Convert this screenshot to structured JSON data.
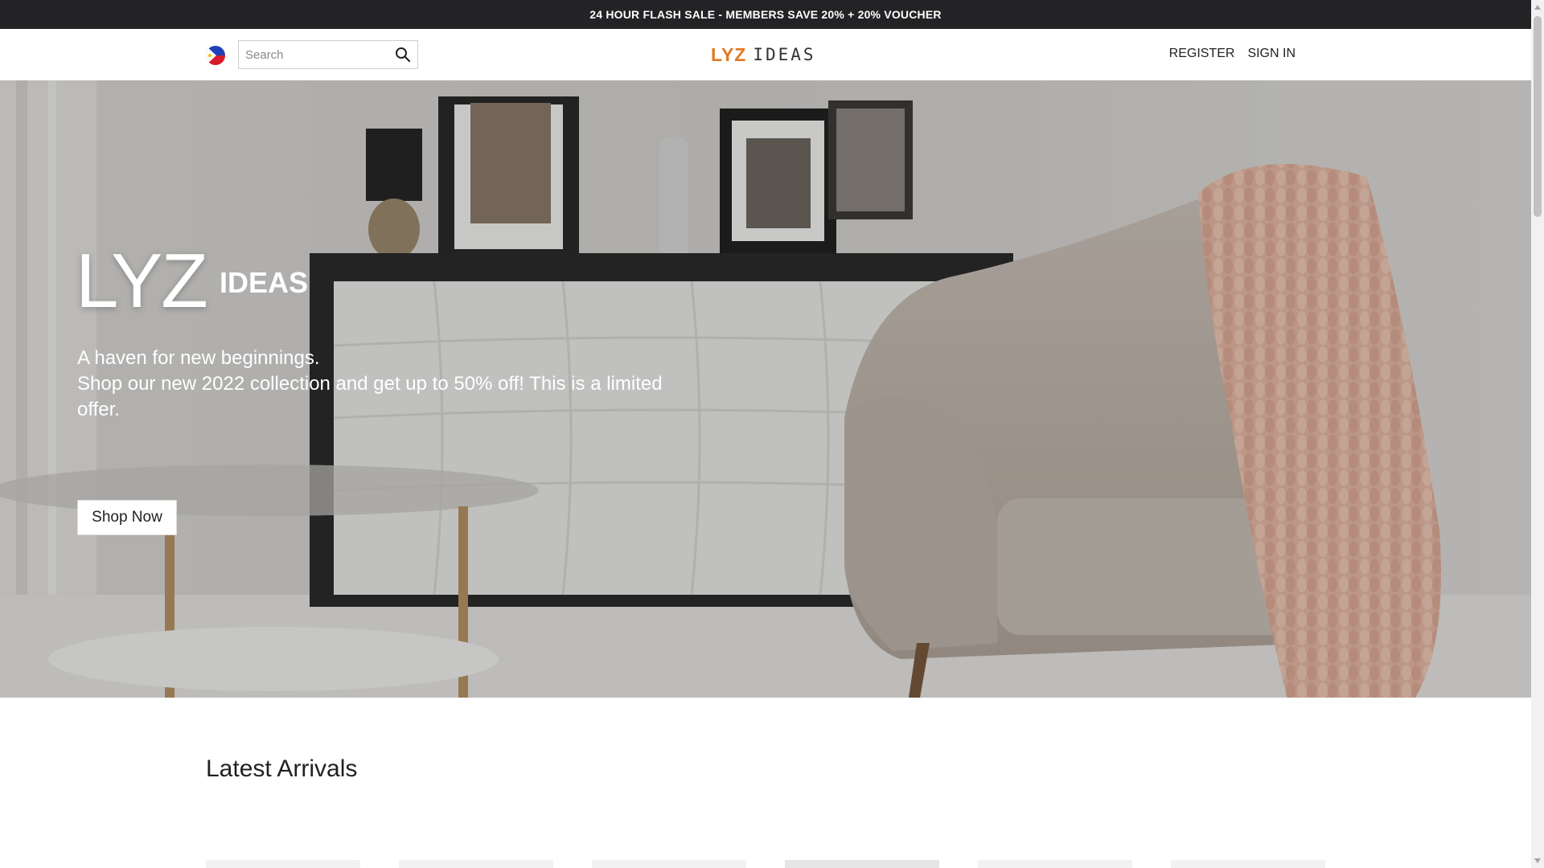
{
  "announcement": "24 HOUR FLASH SALE - MEMBERS SAVE 20% + 20% VOUCHER",
  "header": {
    "search_placeholder": "Search",
    "logo_brand": "LYZ",
    "logo_suffix": "IDEAS",
    "register_label": "REGISTER",
    "signin_label": "SIGN IN"
  },
  "hero": {
    "title_big": "LYZ",
    "title_small": "IDEAS",
    "line1": "A haven for new beginnings.",
    "line2": "Shop our new 2022 collection and get up to 50% off! This is a limited offer.",
    "button_label": "Shop Now"
  },
  "sections": {
    "latest_title": "Latest Arrivals"
  },
  "icons": {
    "flag": "philippines-flag-icon",
    "search": "search-icon"
  },
  "colors": {
    "announcement_bg": "#232326",
    "brand_orange": "#e07a24"
  }
}
